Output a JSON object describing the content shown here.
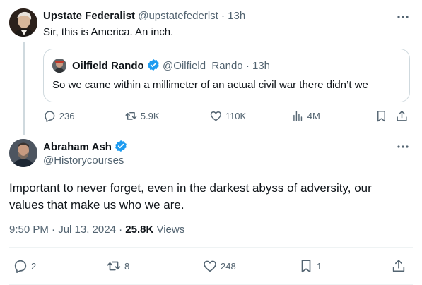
{
  "parent_tweet": {
    "display_name": "Upstate Federalist",
    "handle": "@upstatefederlst",
    "separator": "·",
    "time": "13h",
    "text": "Sir, this is America. An inch.",
    "quoted": {
      "display_name": "Oilfield Rando",
      "handle": "@Oilfield_Rando",
      "separator": "·",
      "time": "13h",
      "text": "So we came within a millimeter of an actual civil war there didn’t we"
    },
    "actions": {
      "replies": "236",
      "reposts": "5.9K",
      "likes": "110K",
      "views": "4M"
    }
  },
  "main_tweet": {
    "display_name": "Abraham Ash",
    "handle": "@Historycourses",
    "text": "Important to never forget, even in the darkest abyss of adversity, our values that make us who we are.",
    "time": "9:50 PM · Jul 13, 2024",
    "meta_separator": "·",
    "views_count": "25.8K",
    "views_label": "Views",
    "actions": {
      "replies": "2",
      "reposts": "8",
      "likes": "248",
      "bookmarks": "1"
    }
  },
  "colors": {
    "verified": "#1d9bf0",
    "muted": "#536471",
    "border": "#cfd9de"
  }
}
